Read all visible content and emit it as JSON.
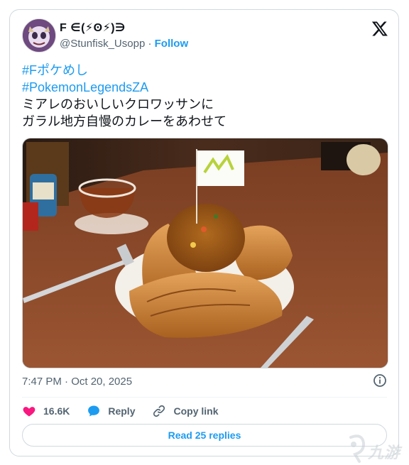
{
  "post": {
    "display_name": "F ∈(⚡ʘ⚡)∋",
    "handle": "@Stunfisk_Usopp",
    "separator": " · ",
    "follow_label": "Follow",
    "hashtags": [
      "#Fポケめし",
      "#PokemonLegendsZA"
    ],
    "body_lines": [
      "ミアレのおいしいクロワッサンに",
      "ガラル地方自慢のカレーをあわせて"
    ],
    "timestamp": "7:47 PM · Oct 20, 2025"
  },
  "actions": {
    "likes": "16.6K",
    "reply_label": "Reply",
    "copy_link_label": "Copy link",
    "read_replies_label": "Read 25 replies"
  },
  "icons": {
    "platform_logo": "x-logo-icon",
    "info": "info-icon",
    "like": "heart-icon",
    "reply": "speech-bubble-icon",
    "copy_link": "link-icon"
  },
  "colors": {
    "accent": "#1d9bf0",
    "like": "#f91880",
    "secondary_text": "#536471",
    "border": "#cfd9de"
  },
  "watermark": {
    "text": "九游"
  }
}
